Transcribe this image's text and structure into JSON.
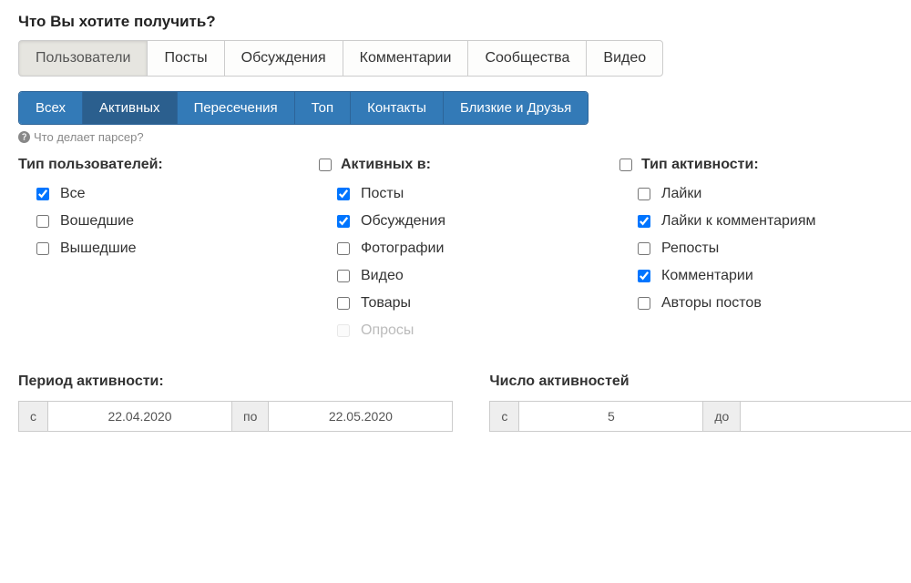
{
  "heading": "Что Вы хотите получить?",
  "tabs": {
    "users": "Пользователи",
    "posts": "Посты",
    "discussions": "Обсуждения",
    "comments": "Комментарии",
    "communities": "Сообщества",
    "video": "Видео"
  },
  "pills": {
    "all": "Всех",
    "active": "Активных",
    "intersection": "Пересечения",
    "top": "Топ",
    "contacts": "Контакты",
    "close_friends": "Близкие и Друзья"
  },
  "parser_help": "Что делает парсер?",
  "columns": {
    "user_type": {
      "title": "Тип пользователей:",
      "items": {
        "all": "Все",
        "joined": "Вошедшие",
        "left": "Вышедшие"
      }
    },
    "active_in": {
      "title": "Активных в:",
      "items": {
        "posts": "Посты",
        "discussions": "Обсуждения",
        "photos": "Фотографии",
        "video": "Видео",
        "goods": "Товары",
        "polls": "Опросы"
      }
    },
    "activity_type": {
      "title": "Тип активности:",
      "items": {
        "likes": "Лайки",
        "comment_likes": "Лайки к комментариям",
        "reposts": "Репосты",
        "comments": "Комментарии",
        "post_authors": "Авторы постов"
      }
    }
  },
  "period": {
    "title": "Период активности:",
    "from_label": "с",
    "from_value": "22.04.2020",
    "to_label": "по",
    "to_value": "22.05.2020"
  },
  "count": {
    "title": "Число активностей",
    "from_label": "с",
    "from_value": "5",
    "to_label": "до",
    "to_value": ""
  }
}
